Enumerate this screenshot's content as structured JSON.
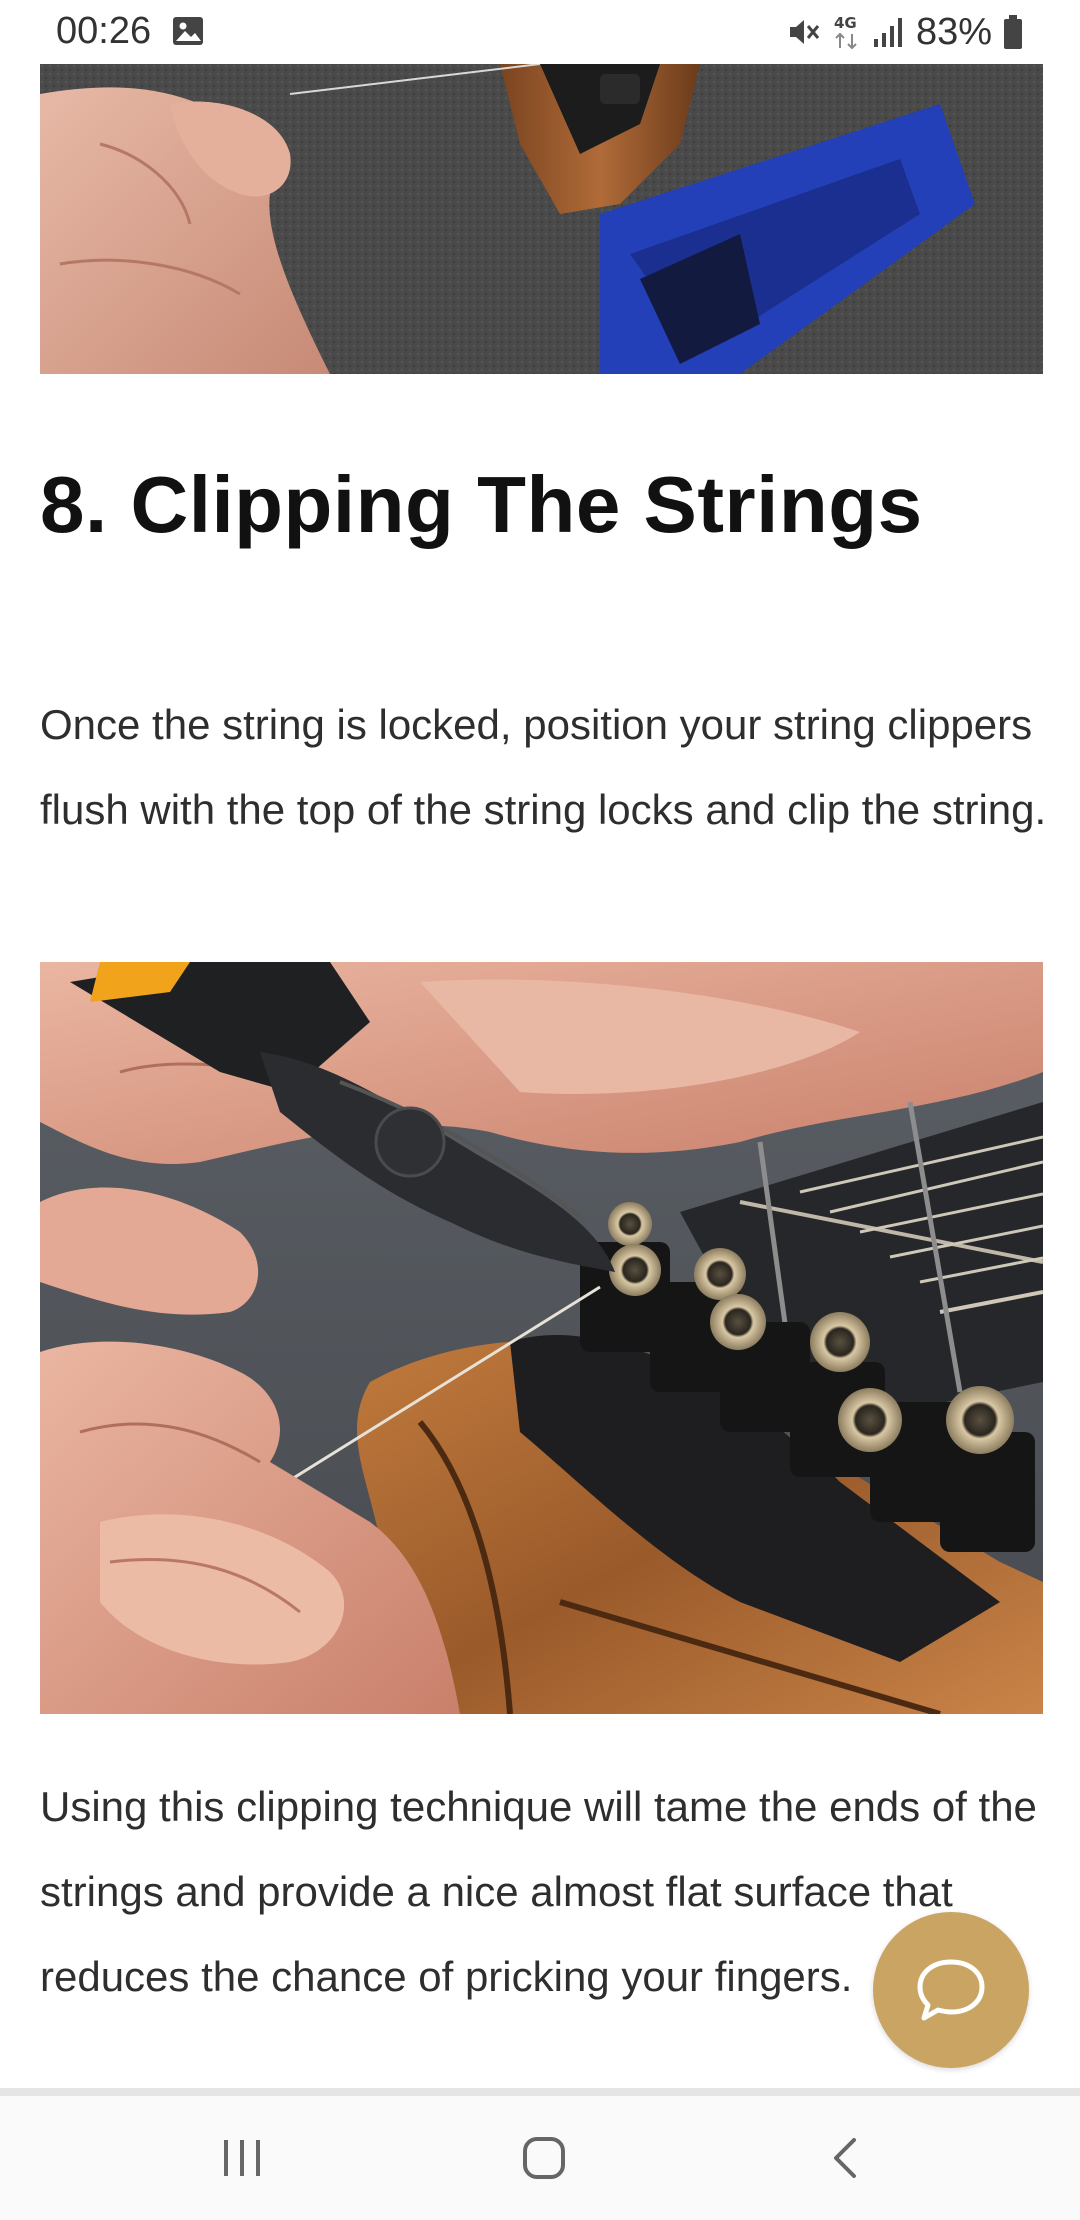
{
  "status_bar": {
    "time": "00:26",
    "battery": "83%",
    "icons": [
      "image-icon",
      "mute-icon",
      "network-4g-icon",
      "signal-icon",
      "battery-icon"
    ]
  },
  "article": {
    "section_heading": "8. Clipping The Strings",
    "paragraph_1": "Once the string is locked, position your string clippers flush with the top of the string locks and clip the string.",
    "paragraph_2": "Using this clipping technique will tame the ends of the strings and provide a nice almost flat surface that reduces the chance of pricking your fingers.",
    "images": [
      {
        "name": "guitar-headstock-on-stand-photo"
      },
      {
        "name": "clipping-string-with-cutters-photo"
      }
    ]
  },
  "chat_button": {
    "icon": "chat-bubble-icon"
  },
  "nav_bar": {
    "icons": [
      "recent-apps-icon",
      "home-icon",
      "back-icon"
    ]
  },
  "colors": {
    "chat_accent": "#c9a463",
    "heading": "#111111",
    "body_text": "#2e2e2e"
  }
}
